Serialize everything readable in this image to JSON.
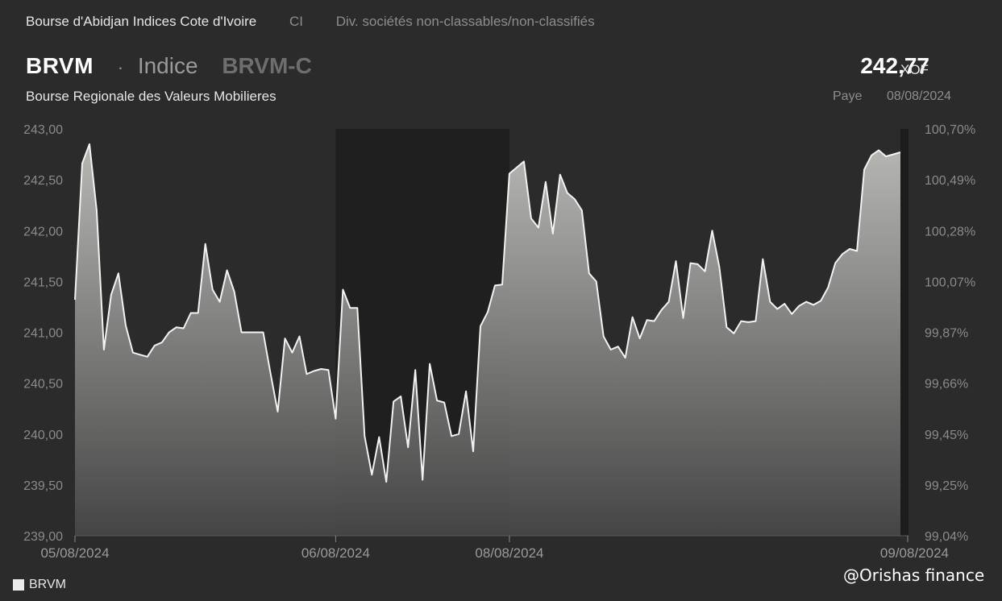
{
  "header": {
    "exchange": "Bourse d'Abidjan Indices Cote d'Ivoire",
    "country_code": "CI",
    "sector": "Div. sociétés non-classables/non-classifiés",
    "ticker": "BRVM",
    "separator": "·",
    "kind": "Indice",
    "code": "BRVM-C",
    "full_name": "Bourse Regionale des Valeurs Mobilieres",
    "price": "242,77",
    "currency": "XOF",
    "country": "Paye",
    "date": "08/08/2024"
  },
  "legend": {
    "label": "BRVM"
  },
  "watermark": "@Orishas finance",
  "colors": {
    "background": "#2b2b2b",
    "line": "#f2f2f2",
    "shade": "#1f1f1f"
  },
  "chart_data": {
    "type": "area",
    "series": [
      {
        "name": "BRVM",
        "values": [
          241.32,
          242.66,
          242.85,
          242.2,
          240.83,
          241.37,
          241.58,
          241.07,
          240.8,
          240.78,
          240.76,
          240.87,
          240.9,
          241.0,
          241.05,
          241.04,
          241.19,
          241.19,
          241.87,
          241.42,
          241.3,
          241.61,
          241.4,
          241.0,
          241.0,
          241.0,
          241.0,
          240.6,
          240.22,
          240.94,
          240.8,
          240.96,
          240.59,
          240.62,
          240.64,
          240.63,
          240.15,
          241.42,
          241.24,
          241.24,
          239.98,
          239.6,
          239.97,
          239.53,
          240.32,
          240.37,
          239.87,
          240.63,
          239.55,
          240.69,
          240.33,
          240.31,
          239.98,
          240.0,
          240.42,
          239.83,
          241.06,
          241.2,
          241.46,
          241.47,
          242.56,
          242.62,
          242.68,
          242.12,
          242.03,
          242.48,
          241.97,
          242.55,
          242.37,
          242.31,
          242.2,
          241.58,
          241.5,
          240.96,
          240.83,
          240.86,
          240.75,
          241.15,
          240.94,
          241.12,
          241.11,
          241.22,
          241.3,
          241.7,
          241.14,
          241.68,
          241.67,
          241.6,
          242.0,
          241.64,
          241.05,
          240.99,
          241.11,
          241.1,
          241.11,
          241.72,
          241.3,
          241.23,
          241.28,
          241.18,
          241.26,
          241.3,
          241.27,
          241.31,
          241.44,
          241.68,
          241.77,
          241.82,
          241.8,
          242.6,
          242.74,
          242.79,
          242.73,
          242.75,
          242.77
        ]
      }
    ],
    "x_tick_labels": [
      "05/08/2024",
      "06/08/2024",
      "08/08/2024",
      "09/08/2024"
    ],
    "x_tick_indices": [
      0,
      36,
      60,
      115
    ],
    "shaded_index_range": [
      36,
      60
    ],
    "ylim": [
      239.0,
      243.0
    ],
    "y_ticks": [
      239.0,
      239.5,
      240.0,
      240.5,
      241.0,
      241.5,
      242.0,
      242.5,
      243.0
    ],
    "y_tick_labels": [
      "239,00",
      "239,50",
      "240,00",
      "240,50",
      "241,00",
      "241,50",
      "242,00",
      "242,50",
      "243,00"
    ],
    "y2_tick_labels": [
      "99,04%",
      "99,25%",
      "99,45%",
      "99,66%",
      "99,87%",
      "100,07%",
      "100,28%",
      "100,49%",
      "100,70%"
    ],
    "legend_position": "bottom-left",
    "grid": false
  }
}
